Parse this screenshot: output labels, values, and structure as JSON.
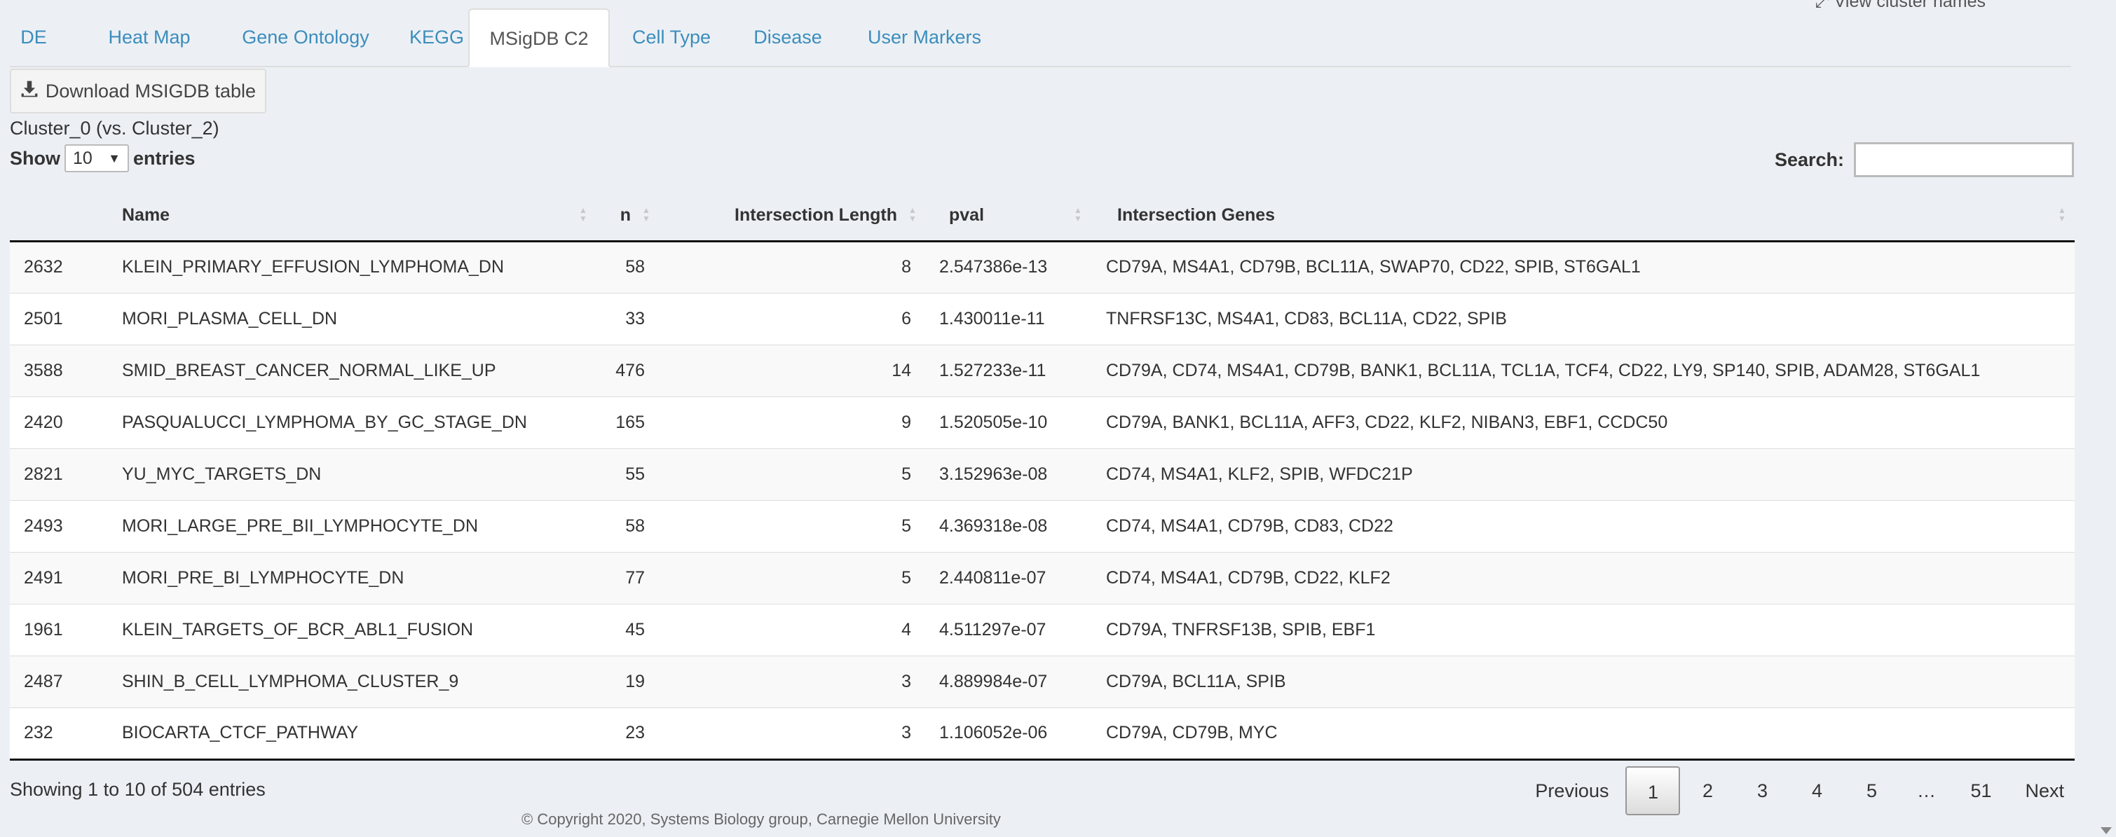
{
  "header": {
    "view_cluster_names": "⤢ View cluster names"
  },
  "tabs": [
    {
      "label": "DE"
    },
    {
      "label": "Heat Map"
    },
    {
      "label": "Gene Ontology"
    },
    {
      "label": "KEGG"
    },
    {
      "label": "MSigDB C2"
    },
    {
      "label": "Cell Type"
    },
    {
      "label": "Disease"
    },
    {
      "label": "User Markers"
    }
  ],
  "active_tab": "MSigDB C2",
  "download_button": {
    "label": "Download MSIGDB table",
    "icon": "download-icon"
  },
  "subtitle": "Cluster_0 (vs. Cluster_2)",
  "length_control": {
    "show": "Show",
    "value": "10",
    "entries": "entries"
  },
  "search": {
    "label": "Search:",
    "value": ""
  },
  "table": {
    "columns": [
      "",
      "Name",
      "n",
      "Intersection Length",
      "pval",
      "Intersection Genes"
    ],
    "rows": [
      {
        "id": "2632",
        "name": "KLEIN_PRIMARY_EFFUSION_LYMPHOMA_DN",
        "n": "58",
        "len": "8",
        "pval": "2.547386e-13",
        "genes": "CD79A, MS4A1, CD79B, BCL11A, SWAP70, CD22, SPIB, ST6GAL1"
      },
      {
        "id": "2501",
        "name": "MORI_PLASMA_CELL_DN",
        "n": "33",
        "len": "6",
        "pval": "1.430011e-11",
        "genes": "TNFRSF13C, MS4A1, CD83, BCL11A, CD22, SPIB"
      },
      {
        "id": "3588",
        "name": "SMID_BREAST_CANCER_NORMAL_LIKE_UP",
        "n": "476",
        "len": "14",
        "pval": "1.527233e-11",
        "genes": "CD79A, CD74, MS4A1, CD79B, BANK1, BCL11A, TCL1A, TCF4, CD22, LY9, SP140, SPIB, ADAM28, ST6GAL1"
      },
      {
        "id": "2420",
        "name": "PASQUALUCCI_LYMPHOMA_BY_GC_STAGE_DN",
        "n": "165",
        "len": "9",
        "pval": "1.520505e-10",
        "genes": "CD79A, BANK1, BCL11A, AFF3, CD22, KLF2, NIBAN3, EBF1, CCDC50"
      },
      {
        "id": "2821",
        "name": "YU_MYC_TARGETS_DN",
        "n": "55",
        "len": "5",
        "pval": "3.152963e-08",
        "genes": "CD74, MS4A1, KLF2, SPIB, WFDC21P"
      },
      {
        "id": "2493",
        "name": "MORI_LARGE_PRE_BII_LYMPHOCYTE_DN",
        "n": "58",
        "len": "5",
        "pval": "4.369318e-08",
        "genes": "CD74, MS4A1, CD79B, CD83, CD22"
      },
      {
        "id": "2491",
        "name": "MORI_PRE_BI_LYMPHOCYTE_DN",
        "n": "77",
        "len": "5",
        "pval": "2.440811e-07",
        "genes": "CD74, MS4A1, CD79B, CD22, KLF2"
      },
      {
        "id": "1961",
        "name": "KLEIN_TARGETS_OF_BCR_ABL1_FUSION",
        "n": "45",
        "len": "4",
        "pval": "4.511297e-07",
        "genes": "CD79A, TNFRSF13B, SPIB, EBF1"
      },
      {
        "id": "2487",
        "name": "SHIN_B_CELL_LYMPHOMA_CLUSTER_9",
        "n": "19",
        "len": "3",
        "pval": "4.889984e-07",
        "genes": "CD79A, BCL11A, SPIB"
      },
      {
        "id": "232",
        "name": "BIOCARTA_CTCF_PATHWAY",
        "n": "23",
        "len": "3",
        "pval": "1.106052e-06",
        "genes": "CD79A, CD79B, MYC"
      }
    ]
  },
  "info": "Showing 1 to 10 of 504 entries",
  "pagination": {
    "previous": "Previous",
    "pages": [
      "1",
      "2",
      "3",
      "4",
      "5",
      "…",
      "51"
    ],
    "current": "1",
    "next": "Next"
  },
  "footer": {
    "copyright": "© Copyright 2020, Systems Biology group, Carnegie Mellon University"
  },
  "colors": {
    "link": "#3c8dbc",
    "background": "#ecf0f5"
  }
}
